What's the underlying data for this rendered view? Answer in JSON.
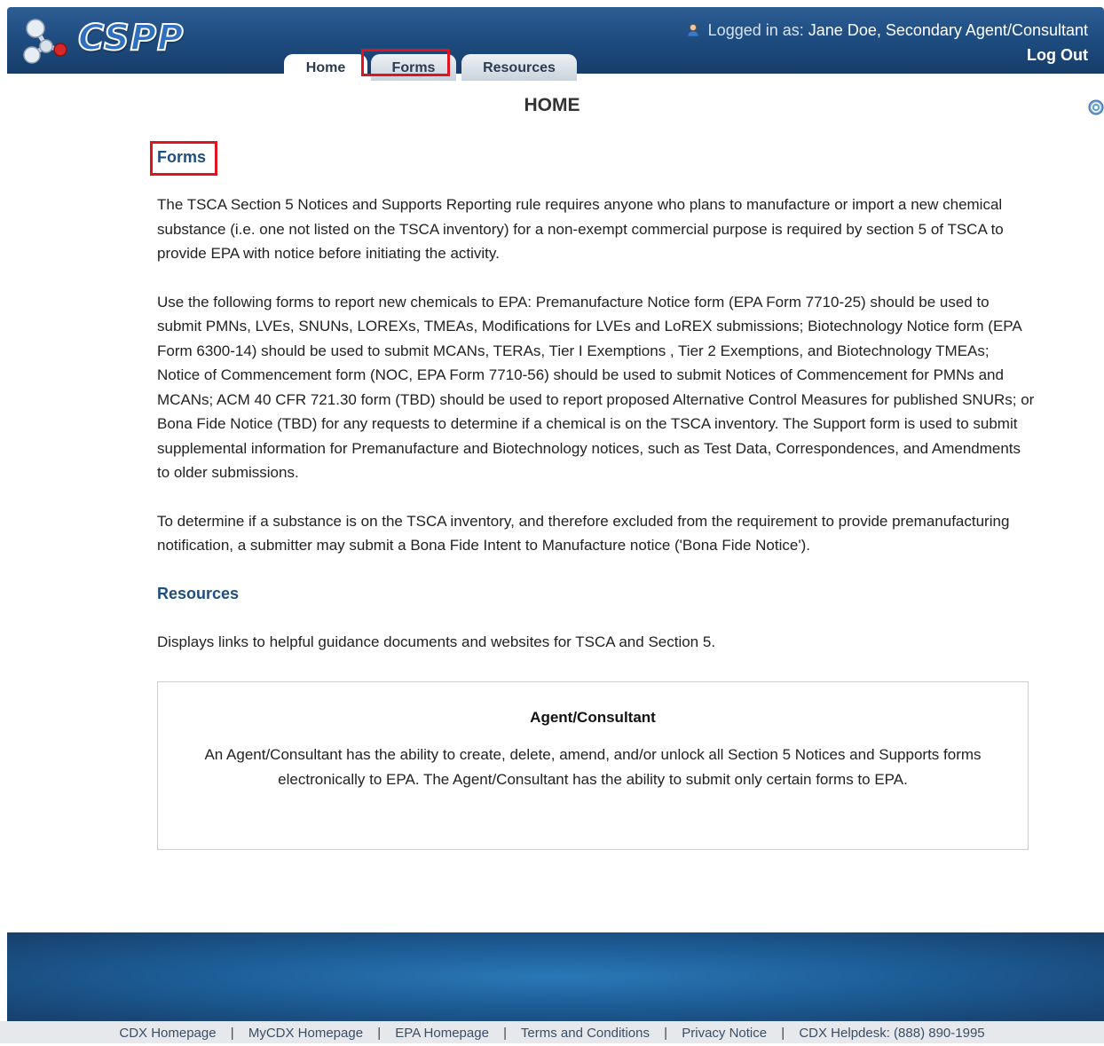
{
  "header": {
    "logo_text": "CSPP",
    "logged_in_label": "Logged in as:",
    "user_name": "Jane Doe, Secondary Agent/Consultant",
    "logout_label": "Log Out"
  },
  "tabs": [
    {
      "label": "Home",
      "active": true
    },
    {
      "label": "Forms",
      "active": false
    },
    {
      "label": "Resources",
      "active": false
    }
  ],
  "page": {
    "title": "HOME",
    "forms_heading": "Forms",
    "forms_paragraphs": [
      "The TSCA Section 5 Notices and Supports Reporting rule requires anyone who plans to manufacture or import a new chemical substance (i.e. one not listed on the TSCA inventory) for a non-exempt commercial purpose is required by section 5 of TSCA to provide EPA with notice before initiating the activity.",
      "Use the following forms to report new chemicals to EPA: Premanufacture Notice form (EPA Form 7710-25) should be used to submit PMNs, LVEs, SNUNs, LOREXs, TMEAs, Modifications for LVEs and LoREX submissions; Biotechnology Notice form (EPA Form 6300-14) should be used to submit MCANs, TERAs, Tier I Exemptions , Tier 2 Exemptions, and Biotechnology TMEAs; Notice of Commencement form (NOC, EPA Form 7710-56) should be used to submit Notices of Commencement for PMNs and MCANs; ACM 40 CFR 721.30 form (TBD) should be used to report proposed Alternative Control Measures for published SNURs; or Bona Fide Notice (TBD) for any requests to determine if a chemical is on the TSCA inventory. The Support form is used to submit supplemental information for Premanufacture and Biotechnology notices, such as Test Data, Correspondences, and Amendments to older submissions.",
      "To determine if a substance is on the TSCA inventory, and therefore excluded from the requirement to provide premanufacturing notification, a submitter may submit a Bona Fide Intent to Manufacture notice ('Bona Fide Notice')."
    ],
    "resources_heading": "Resources",
    "resources_text": "Displays links to helpful guidance documents and websites for TSCA and Section 5.",
    "agent_box": {
      "title": "Agent/Consultant",
      "text": "An Agent/Consultant has the ability to create, delete, amend, and/or unlock all Section 5 Notices and Supports forms electronically to EPA. The Agent/Consultant has the ability to submit only certain forms to EPA."
    }
  },
  "footer": {
    "links": [
      "CDX Homepage",
      "MyCDX Homepage",
      "EPA Homepage",
      "Terms and Conditions",
      "Privacy Notice",
      "CDX Helpdesk: (888) 890-1995"
    ],
    "separator": "|"
  },
  "annotations": {
    "highlight_color": "#e0141e"
  },
  "colors": {
    "header_blue": "#1d4a7d",
    "heading_blue": "#1f4e80"
  }
}
